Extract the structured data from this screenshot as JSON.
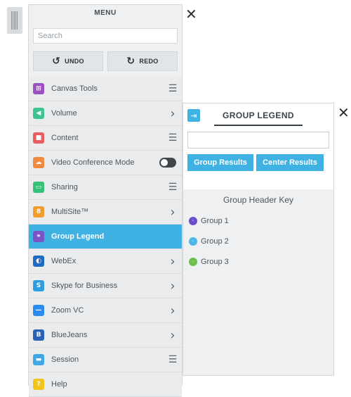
{
  "menu": {
    "title": "MENU",
    "search_placeholder": "Search",
    "undo_label": "UNDO",
    "redo_label": "REDO",
    "undo_icon": "↺",
    "redo_icon": "↻",
    "items": [
      {
        "label": "Canvas Tools",
        "icon": "canvas-tools-icon",
        "color": "#9b4fc0",
        "glyph": "⊞",
        "trail": "list"
      },
      {
        "label": "Volume",
        "icon": "volume-icon",
        "color": "#3cc58e",
        "glyph": "◀",
        "trail": "chevron"
      },
      {
        "label": "Content",
        "icon": "content-icon",
        "color": "#e95d5d",
        "glyph": "■",
        "trail": "list"
      },
      {
        "label": "Video Conference Mode",
        "icon": "video-conference-icon",
        "color": "#f08a3c",
        "glyph": "☁",
        "trail": "toggle"
      },
      {
        "label": "Sharing",
        "icon": "sharing-icon",
        "color": "#35c17a",
        "glyph": "▭",
        "trail": "list"
      },
      {
        "label": "MultiSite™",
        "icon": "multisite-icon",
        "color": "#f29b2e",
        "glyph": "8",
        "trail": "chevron"
      },
      {
        "label": "Group Legend",
        "icon": "group-legend-icon",
        "color": "#7a55c6",
        "glyph": "⚭",
        "trail": "none",
        "active": true
      },
      {
        "label": "WebEx",
        "icon": "webex-icon",
        "color": "#1f6bc2",
        "glyph": "◐",
        "trail": "chevron"
      },
      {
        "label": "Skype for Business",
        "icon": "skype-icon",
        "color": "#2f9ee0",
        "glyph": "S",
        "trail": "chevron"
      },
      {
        "label": "Zoom VC",
        "icon": "zoom-icon",
        "color": "#2b8cf0",
        "glyph": "—",
        "trail": "chevron"
      },
      {
        "label": "BlueJeans",
        "icon": "bluejeans-icon",
        "color": "#2a62b8",
        "glyph": "B",
        "trail": "chevron"
      },
      {
        "label": "Session",
        "icon": "session-icon",
        "color": "#3fa8e6",
        "glyph": "▬",
        "trail": "list"
      },
      {
        "label": "Help",
        "icon": "help-icon",
        "color": "#f3c51c",
        "glyph": "?",
        "trail": "none"
      }
    ]
  },
  "legend": {
    "title": "GROUP LEGEND",
    "input_value": "",
    "group_results_label": "Group Results",
    "center_results_label": "Center Results",
    "key_title": "Group Header Key",
    "groups": [
      {
        "label": "Group 1",
        "color": "#6a4ec9"
      },
      {
        "label": "Group 2",
        "color": "#4fb6e8"
      },
      {
        "label": "Group 3",
        "color": "#6cc04a"
      }
    ]
  },
  "colors": {
    "accent": "#3fb1e3"
  }
}
